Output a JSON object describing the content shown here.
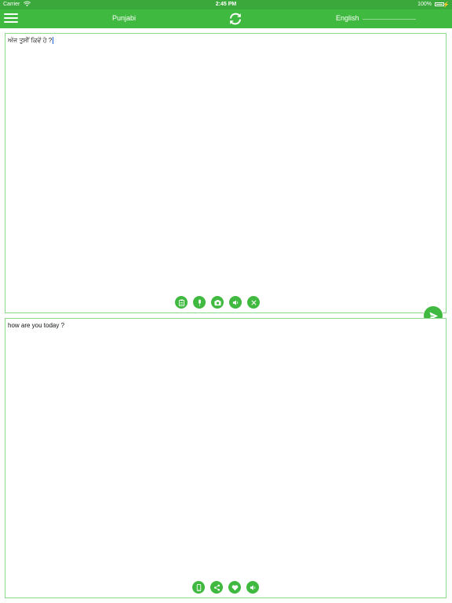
{
  "status_bar": {
    "carrier": "Carrier",
    "time": "2:45 PM",
    "battery": "100%"
  },
  "nav": {
    "menu_icon": "hamburger-menu-icon",
    "source_language": "Punjabi",
    "target_language": "English",
    "swap_icon": "swap-refresh-icon"
  },
  "input_panel": {
    "text": "ਅੱਜ ਤੁਸੀਂ ਕਿਵੇਂ ਹੋ ?",
    "tools": [
      "clipboard-icon",
      "microphone-icon",
      "camera-icon",
      "speaker-icon",
      "clear-icon"
    ]
  },
  "send_icon": "send-icon",
  "output_panel": {
    "text": "how are you today ?",
    "tools": [
      "copy-icon",
      "share-icon",
      "favorite-heart-icon",
      "speaker-icon"
    ]
  },
  "colors": {
    "status_bar": "#3aa83a",
    "nav_bar": "#3fb93f",
    "panel_border": "#8cd88c",
    "accent": "#3fb93f"
  }
}
